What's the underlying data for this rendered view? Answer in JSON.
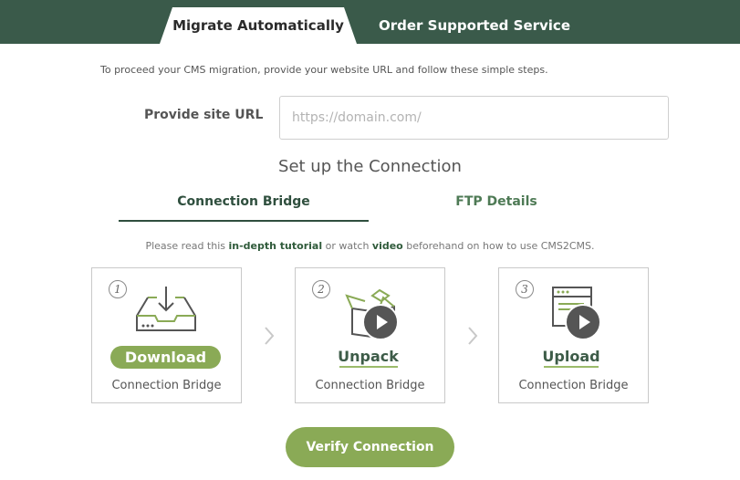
{
  "tabs": {
    "active_label": "Migrate Automatically",
    "inactive_label": "Order Supported Service"
  },
  "intro_text": "To proceed your CMS migration, provide your website URL and follow these simple steps.",
  "url_field": {
    "label": "Provide site URL",
    "placeholder": "https://domain.com/",
    "value": ""
  },
  "setup_title": "Set up the Connection",
  "subtabs": {
    "bridge_label": "Connection Bridge",
    "ftp_label": "FTP Details"
  },
  "note": {
    "before": "Please read this ",
    "tutorial_link": "in-depth tutorial",
    "middle": " or watch ",
    "video_link": "video",
    "after": " beforehand on how to use CMS2CMS."
  },
  "steps": [
    {
      "number": "1",
      "action": "Download",
      "subtitle": "Connection Bridge",
      "icon": "download-tray-icon"
    },
    {
      "number": "2",
      "action": "Unpack",
      "subtitle": "Connection Bridge",
      "icon": "open-box-icon"
    },
    {
      "number": "3",
      "action": "Upload",
      "subtitle": "Connection Bridge",
      "icon": "browser-window-icon"
    }
  ],
  "verify_button": "Verify Connection",
  "colors": {
    "header_bg": "#3a5a4a",
    "accent_green": "#8aaa56",
    "dark_green": "#2f4f3e"
  }
}
